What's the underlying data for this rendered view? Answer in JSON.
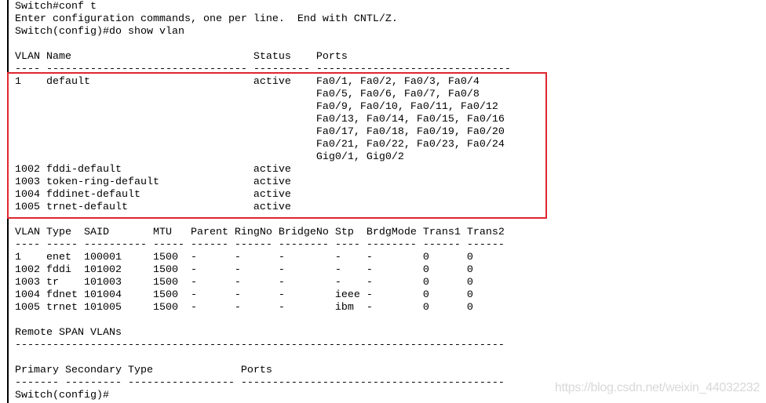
{
  "terminal": {
    "lines": [
      "Switch#conf t",
      "Enter configuration commands, one per line.  End with CNTL/Z.",
      "Switch(config)#do show vlan",
      "",
      "VLAN Name                             Status    Ports",
      "---- -------------------------------- --------- -------------------------------",
      "1    default                          active    Fa0/1, Fa0/2, Fa0/3, Fa0/4",
      "                                                Fa0/5, Fa0/6, Fa0/7, Fa0/8",
      "                                                Fa0/9, Fa0/10, Fa0/11, Fa0/12",
      "                                                Fa0/13, Fa0/14, Fa0/15, Fa0/16",
      "                                                Fa0/17, Fa0/18, Fa0/19, Fa0/20",
      "                                                Fa0/21, Fa0/22, Fa0/23, Fa0/24",
      "                                                Gig0/1, Gig0/2",
      "1002 fddi-default                     active",
      "1003 token-ring-default               active",
      "1004 fddinet-default                  active",
      "1005 trnet-default                    active",
      "",
      "VLAN Type  SAID       MTU   Parent RingNo BridgeNo Stp  BrdgMode Trans1 Trans2",
      "---- ----- ---------- ----- ------ ------ -------- ---- -------- ------ ------",
      "1    enet  100001     1500  -      -      -        -    -        0      0",
      "1002 fddi  101002     1500  -      -      -        -    -        0      0",
      "1003 tr    101003     1500  -      -      -        -    -        0      0",
      "1004 fdnet 101004     1500  -      -      -        ieee -        0      0",
      "1005 trnet 101005     1500  -      -      -        ibm  -        0      0",
      "",
      "Remote SPAN VLANs",
      "------------------------------------------------------------------------------",
      "",
      "Primary Secondary Type              Ports",
      "------- --------- ----------------- ------------------------------------------",
      "Switch(config)#"
    ]
  },
  "highlight_color": "#e0262f",
  "watermark": "https://blog.csdn.net/weixin_44032232"
}
